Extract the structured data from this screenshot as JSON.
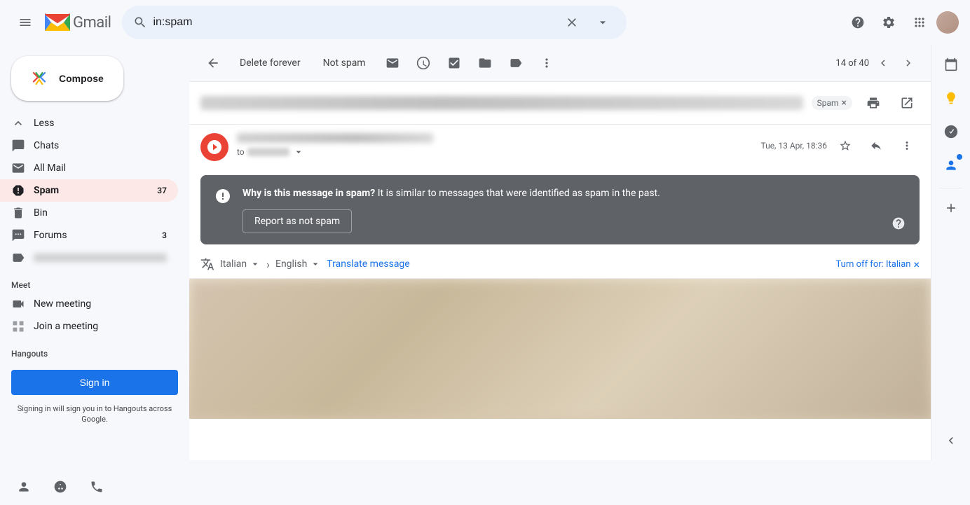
{
  "topbar": {
    "search_placeholder": "in:spam",
    "gmail_label": "Gmail"
  },
  "sidebar": {
    "compose_label": "Compose",
    "nav_items": [
      {
        "id": "less",
        "label": "Less",
        "icon": "chevron-up",
        "count": null,
        "active": false
      },
      {
        "id": "chats",
        "label": "Chats",
        "icon": "chat",
        "count": null,
        "active": false
      },
      {
        "id": "all-mail",
        "label": "All Mail",
        "icon": "mail",
        "count": null,
        "active": false
      },
      {
        "id": "spam",
        "label": "Spam",
        "icon": "report-spam",
        "count": "37",
        "active": true
      },
      {
        "id": "bin",
        "label": "Bin",
        "icon": "trash",
        "count": null,
        "active": false
      },
      {
        "id": "forums",
        "label": "Forums",
        "icon": "forum",
        "count": "3",
        "active": false
      }
    ],
    "meet_header": "Meet",
    "new_meeting_label": "New meeting",
    "join_meeting_label": "Join a meeting",
    "hangouts_header": "Hangouts",
    "sign_in_label": "Sign in",
    "hangouts_signin_text": "Signing in will sign you in to Hangouts across Google."
  },
  "toolbar": {
    "delete_forever_label": "Delete forever",
    "not_spam_label": "Not spam",
    "pagination_text": "14 of 40"
  },
  "email": {
    "spam_badge_label": "Spam",
    "sender_date": "Tue, 13 Apr, 18:36",
    "to_label": "to",
    "spam_notice": {
      "title_bold": "Why is this message in spam?",
      "title_rest": " It is similar to messages that were identified as spam in the past.",
      "report_btn_label": "Report as not spam"
    },
    "translate": {
      "from_lang": "Italian",
      "to_lang": "English",
      "translate_btn": "Translate message",
      "turn_off_label": "Turn off for: Italian"
    }
  }
}
